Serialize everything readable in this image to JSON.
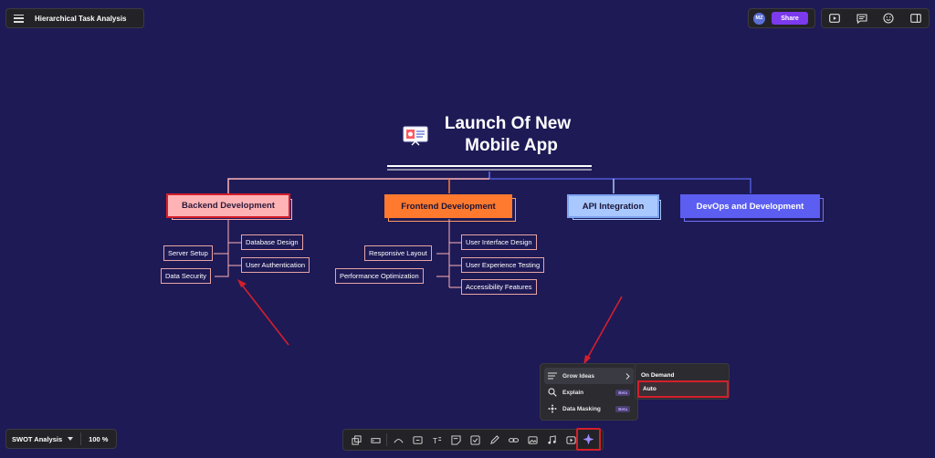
{
  "header": {
    "doc_title": "Hierarchical Task Analysis",
    "avatar_initials": "MZ",
    "share_label": "Share"
  },
  "mindmap": {
    "title_line1": "Launch Of New",
    "title_line2": "Mobile   App",
    "branches": [
      {
        "label": "Backend Development",
        "color": "#ffb3b5",
        "children": [
          "Database Design",
          "User Authentication",
          "Server Setup",
          "Data Security"
        ]
      },
      {
        "label": "Frontend Development",
        "color": "#ff7a2f",
        "children": [
          "User Interface Design",
          "User Experience Testing",
          "Accessibility Features",
          "Responsive Layout",
          "Performance Optimization"
        ]
      },
      {
        "label": "API Integration",
        "color": "#a8c8ff",
        "children": []
      },
      {
        "label": "DevOps and Development",
        "color": "#5b5ef0",
        "children": []
      }
    ]
  },
  "ai_menu": {
    "items": [
      {
        "label": "Grow Ideas",
        "icon": "list-icon"
      },
      {
        "label": "Explain",
        "icon": "search-icon",
        "badge": "Beta"
      },
      {
        "label": "Data Masking",
        "icon": "mask-icon",
        "badge": "Beta"
      }
    ],
    "submenu": [
      "On Demand",
      "Auto"
    ]
  },
  "footer": {
    "doc_name": "SWOT Analysis",
    "zoom": "100 %"
  },
  "colors": {
    "canvas": "#1e1a56",
    "accent": "#7c3aed",
    "highlight": "#d41f2b"
  }
}
